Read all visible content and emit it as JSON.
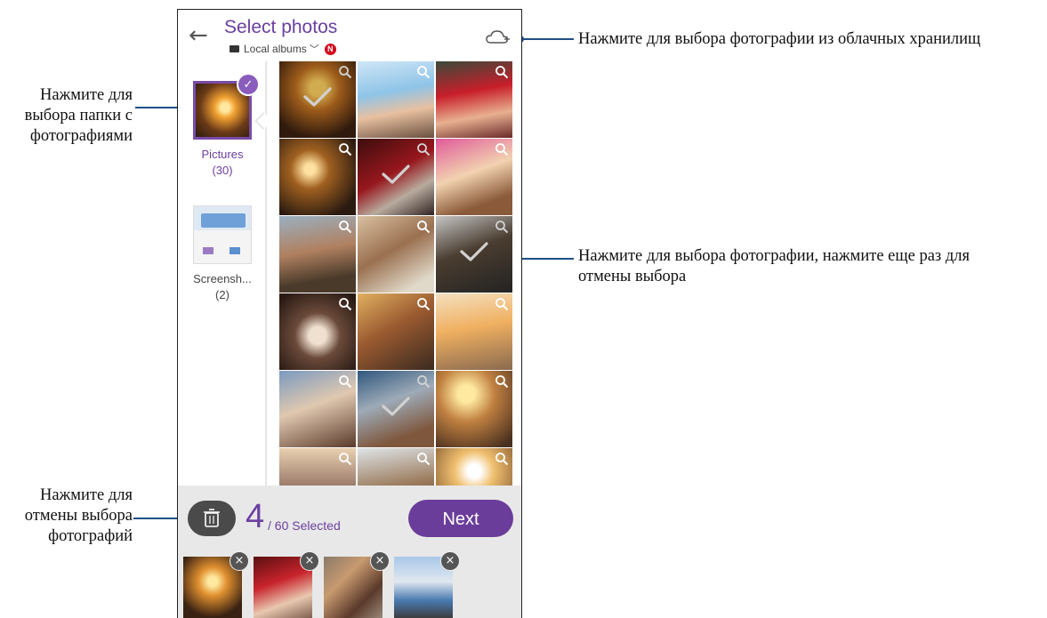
{
  "annotations": {
    "cloud": "Нажмите для выбора фотографии из облачных хранилищ",
    "folder": [
      "Нажмите для",
      "выбора папки с",
      "фотографиями"
    ],
    "photo": [
      "Нажмите для выбора фотографии, нажмите еще раз для",
      "отмены выбора"
    ],
    "deselect": [
      "Нажмите для",
      "отмены выбора",
      "фотографий"
    ]
  },
  "header": {
    "title": "Select photos",
    "source": "Local albums",
    "badge": "N"
  },
  "albums": [
    {
      "name": "Pictures",
      "count": "(30)",
      "selected": true
    },
    {
      "name": "Screensh...",
      "count": "(2)",
      "selected": false
    }
  ],
  "grid": [
    {
      "icon": "photo-thumbnail",
      "selected": true
    },
    {
      "icon": "photo-thumbnail",
      "selected": false
    },
    {
      "icon": "photo-thumbnail",
      "selected": false
    },
    {
      "icon": "photo-thumbnail",
      "selected": false
    },
    {
      "icon": "photo-thumbnail",
      "selected": true
    },
    {
      "icon": "photo-thumbnail",
      "selected": false
    },
    {
      "icon": "photo-thumbnail",
      "selected": false
    },
    {
      "icon": "photo-thumbnail",
      "selected": false
    },
    {
      "icon": "photo-thumbnail",
      "selected": true
    },
    {
      "icon": "photo-thumbnail",
      "selected": false
    },
    {
      "icon": "photo-thumbnail",
      "selected": false
    },
    {
      "icon": "photo-thumbnail",
      "selected": false
    },
    {
      "icon": "photo-thumbnail",
      "selected": false
    },
    {
      "icon": "photo-thumbnail",
      "selected": true
    },
    {
      "icon": "photo-thumbnail",
      "selected": false
    },
    {
      "icon": "photo-thumbnail",
      "selected": false
    },
    {
      "icon": "photo-thumbnail",
      "selected": false
    },
    {
      "icon": "photo-thumbnail",
      "selected": false
    }
  ],
  "selection": {
    "count": "4",
    "total_label": "/ 60 Selected",
    "next_label": "Next",
    "remove_glyph": "×"
  },
  "colors": {
    "accent": "#6a3fa0",
    "annotation_line": "#1e4f86",
    "bottom_bar": "#e8e8e8"
  }
}
